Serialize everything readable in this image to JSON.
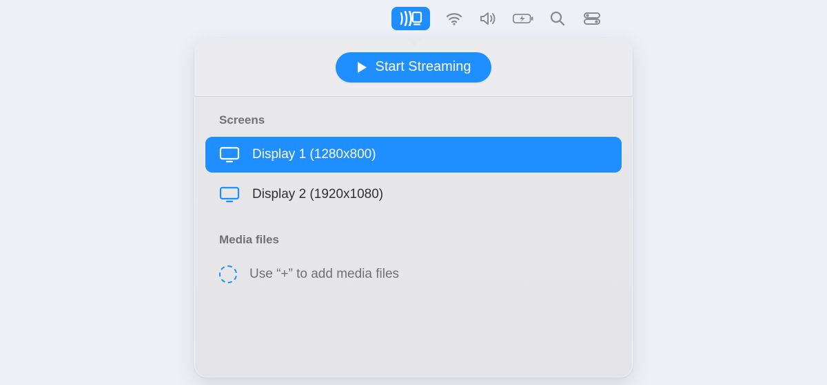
{
  "colors": {
    "accent": "#1f8fff",
    "mutedText": "#707075",
    "panelBg": "#e9e9ec"
  },
  "menubar": {
    "active_icon": "cast-icon",
    "icons": [
      "wifi-icon",
      "volume-icon",
      "battery-charging-icon",
      "search-icon",
      "control-center-icon"
    ]
  },
  "popover": {
    "start_button": "Start Streaming",
    "sections": {
      "screens": {
        "label": "Screens",
        "items": [
          {
            "label": "Display 1 (1280x800)",
            "selected": true
          },
          {
            "label": "Display 2 (1920x1080)",
            "selected": false
          }
        ]
      },
      "media": {
        "label": "Media files",
        "placeholder": "Use “+” to add media files"
      }
    }
  }
}
